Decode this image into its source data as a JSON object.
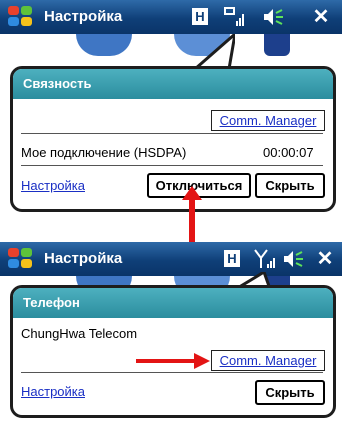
{
  "screens": [
    {
      "app_title": "Настройка",
      "status_badge": "H",
      "balloon_title": "Связность",
      "comm_manager": "Comm. Manager",
      "connection_label": "Мое подключение (HSDPA)",
      "connection_time": "00:00:07",
      "settings_link": "Настройка",
      "disconnect_button": "Отключиться",
      "hide_button": "Скрыть"
    },
    {
      "app_title": "Настройка",
      "status_badge": "H",
      "balloon_title": "Телефон",
      "operator_name": "ChungHwa Telecom",
      "comm_manager": "Comm. Manager",
      "settings_link": "Настройка",
      "hide_button": "Скрыть"
    }
  ],
  "colors": {
    "titlebar": "#0f3f78",
    "balloon_header": "#2b8d9e",
    "link": "#1a2fc4",
    "arrow": "#e31414"
  },
  "icons": [
    "windows-start-icon",
    "signal-icon",
    "volume-icon",
    "close-icon"
  ]
}
